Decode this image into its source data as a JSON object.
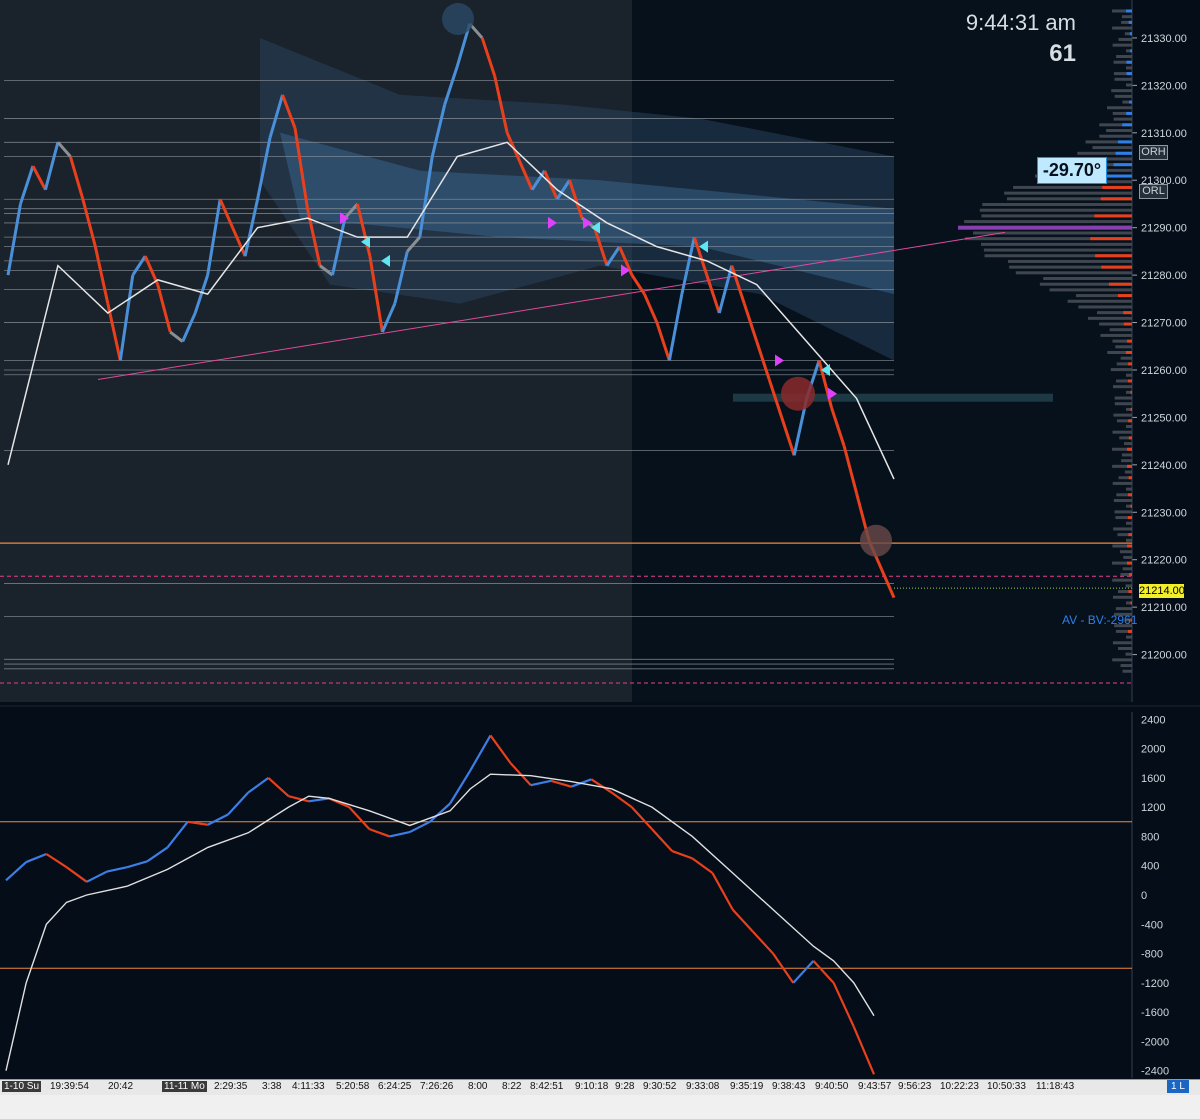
{
  "clock": {
    "time": "9:44:31 am",
    "count": "61"
  },
  "angle_badge": "-29.70°",
  "av_bv_label": "AV - BV:-2961",
  "last_price_tag": "21214.00",
  "level_tags": [
    "ORH",
    "ORL"
  ],
  "pane_markers": [
    "1 L"
  ],
  "colors": {
    "background": "#040d18",
    "session_shade": "#1b2430",
    "bull": "#4a90d9",
    "bear": "#e8401c",
    "neutral": "#8a8f94",
    "ma": "#e6e6e6",
    "orange_level": "#f08a3e",
    "pink_level": "#e83e8c",
    "trendline": "#e04a9a",
    "magenta_marker": "#e040fb",
    "cyan_marker": "#5fe6f0",
    "price_tag": "#f2ee2a"
  },
  "chart_data": [
    {
      "type": "line",
      "title": "",
      "ylim": [
        21190,
        21338
      ],
      "y_ticks": [
        "21330.00",
        "21320.00",
        "21310.00",
        "21300.00",
        "21290.00",
        "21280.00",
        "21270.00",
        "21260.00",
        "21250.00",
        "21240.00",
        "21230.00",
        "21220.00",
        "21210.00",
        "21200.00"
      ],
      "y_tick_values": [
        21330,
        21320,
        21310,
        21300,
        21290,
        21280,
        21270,
        21260,
        21250,
        21240,
        21230,
        21220,
        21210,
        21200
      ],
      "last_price": 21214.0,
      "orange_level": 21223.5,
      "pink_dashed_levels": [
        21216.5,
        21194
      ],
      "horizontal_levels": [
        21321,
        21313,
        21308,
        21305,
        21296,
        21294,
        21293,
        21291,
        21288,
        21286,
        21283,
        21281,
        21277,
        21270,
        21262,
        21260,
        21259,
        21243,
        21215,
        21208,
        21199,
        21198,
        21197
      ],
      "or_high": 21297,
      "or_low": 21294,
      "poc": 21290,
      "price_series": [
        {
          "x": 0,
          "y": 21280
        },
        {
          "x": 1,
          "y": 21295
        },
        {
          "x": 2,
          "y": 21303
        },
        {
          "x": 3,
          "y": 21298
        },
        {
          "x": 4,
          "y": 21308
        },
        {
          "x": 5,
          "y": 21305
        },
        {
          "x": 6,
          "y": 21296
        },
        {
          "x": 7,
          "y": 21286
        },
        {
          "x": 8,
          "y": 21274
        },
        {
          "x": 9,
          "y": 21262
        },
        {
          "x": 10,
          "y": 21280
        },
        {
          "x": 11,
          "y": 21284
        },
        {
          "x": 12,
          "y": 21278
        },
        {
          "x": 13,
          "y": 21268
        },
        {
          "x": 14,
          "y": 21266
        },
        {
          "x": 15,
          "y": 21272
        },
        {
          "x": 16,
          "y": 21280
        },
        {
          "x": 17,
          "y": 21296
        },
        {
          "x": 18,
          "y": 21290
        },
        {
          "x": 19,
          "y": 21284
        },
        {
          "x": 20,
          "y": 21296
        },
        {
          "x": 21,
          "y": 21309
        },
        {
          "x": 22,
          "y": 21318
        },
        {
          "x": 23,
          "y": 21311
        },
        {
          "x": 24,
          "y": 21294
        },
        {
          "x": 25,
          "y": 21282
        },
        {
          "x": 26,
          "y": 21280
        },
        {
          "x": 27,
          "y": 21292
        },
        {
          "x": 28,
          "y": 21295
        },
        {
          "x": 29,
          "y": 21284
        },
        {
          "x": 30,
          "y": 21268
        },
        {
          "x": 31,
          "y": 21274
        },
        {
          "x": 32,
          "y": 21285
        },
        {
          "x": 33,
          "y": 21288
        },
        {
          "x": 34,
          "y": 21305
        },
        {
          "x": 35,
          "y": 21316
        },
        {
          "x": 36,
          "y": 21324
        },
        {
          "x": 37,
          "y": 21333
        },
        {
          "x": 38,
          "y": 21330
        },
        {
          "x": 39,
          "y": 21322
        },
        {
          "x": 40,
          "y": 21310
        },
        {
          "x": 41,
          "y": 21304
        },
        {
          "x": 42,
          "y": 21298
        },
        {
          "x": 43,
          "y": 21302
        },
        {
          "x": 44,
          "y": 21296
        },
        {
          "x": 45,
          "y": 21300
        },
        {
          "x": 46,
          "y": 21292
        },
        {
          "x": 47,
          "y": 21290
        },
        {
          "x": 48,
          "y": 21282
        },
        {
          "x": 49,
          "y": 21286
        },
        {
          "x": 50,
          "y": 21280
        },
        {
          "x": 51,
          "y": 21276
        },
        {
          "x": 52,
          "y": 21270
        },
        {
          "x": 53,
          "y": 21262
        },
        {
          "x": 54,
          "y": 21276
        },
        {
          "x": 55,
          "y": 21288
        },
        {
          "x": 56,
          "y": 21280
        },
        {
          "x": 57,
          "y": 21272
        },
        {
          "x": 58,
          "y": 21282
        },
        {
          "x": 59,
          "y": 21274
        },
        {
          "x": 60,
          "y": 21266
        },
        {
          "x": 61,
          "y": 21258
        },
        {
          "x": 62,
          "y": 21250
        },
        {
          "x": 63,
          "y": 21242
        },
        {
          "x": 64,
          "y": 21254
        },
        {
          "x": 65,
          "y": 21262
        },
        {
          "x": 66,
          "y": 21252
        },
        {
          "x": 67,
          "y": 21244
        },
        {
          "x": 68,
          "y": 21234
        },
        {
          "x": 69,
          "y": 21224
        },
        {
          "x": 70,
          "y": 21218
        },
        {
          "x": 71,
          "y": 21212
        }
      ],
      "moving_average": [
        {
          "x": 0,
          "y": 21240
        },
        {
          "x": 4,
          "y": 21282
        },
        {
          "x": 8,
          "y": 21272
        },
        {
          "x": 12,
          "y": 21279
        },
        {
          "x": 16,
          "y": 21276
        },
        {
          "x": 20,
          "y": 21290
        },
        {
          "x": 24,
          "y": 21292
        },
        {
          "x": 28,
          "y": 21288
        },
        {
          "x": 32,
          "y": 21288
        },
        {
          "x": 36,
          "y": 21305
        },
        {
          "x": 40,
          "y": 21308
        },
        {
          "x": 44,
          "y": 21298
        },
        {
          "x": 48,
          "y": 21291
        },
        {
          "x": 52,
          "y": 21286
        },
        {
          "x": 56,
          "y": 21283
        },
        {
          "x": 60,
          "y": 21278
        },
        {
          "x": 64,
          "y": 21266
        },
        {
          "x": 68,
          "y": 21254
        },
        {
          "x": 71,
          "y": 21237
        }
      ],
      "x_ticks": [
        "1-10 Su",
        "19:39:54",
        "20:42",
        "11-11 Mo",
        "2:29:35",
        "3:38",
        "4:11:33",
        "5:20:58",
        "6:24:25",
        "7:26:26",
        "8:00",
        "8:22",
        "8:42:51",
        "9:10:18",
        "9:28",
        "9:30:52",
        "9:33:08",
        "9:35:19",
        "9:38:43",
        "9:40:50",
        "9:43:57",
        "9:56:23",
        "10:22:23",
        "10:50:33",
        "11:18:43"
      ]
    },
    {
      "type": "line",
      "title": "",
      "ylim": [
        -2500,
        2500
      ],
      "y_ticks": [
        "2400",
        "2000",
        "1600",
        "1200",
        "800",
        "400",
        "0",
        "-400",
        "-800",
        "-1200",
        "-1600",
        "-2000",
        "-2400"
      ],
      "y_tick_values": [
        2400,
        2000,
        1600,
        1200,
        800,
        400,
        0,
        -400,
        -800,
        -1200,
        -1600,
        -2000,
        -2400
      ],
      "orange_levels": [
        1000,
        -1000
      ],
      "series": [
        {
          "values": [
            {
              "x": 0,
              "y": 200
            },
            {
              "x": 2,
              "y": 450
            },
            {
              "x": 4,
              "y": 560
            },
            {
              "x": 6,
              "y": 380
            },
            {
              "x": 8,
              "y": 180
            },
            {
              "x": 10,
              "y": 320
            },
            {
              "x": 12,
              "y": 380
            },
            {
              "x": 14,
              "y": 460
            },
            {
              "x": 16,
              "y": 650
            },
            {
              "x": 18,
              "y": 1000
            },
            {
              "x": 20,
              "y": 960
            },
            {
              "x": 22,
              "y": 1100
            },
            {
              "x": 24,
              "y": 1400
            },
            {
              "x": 26,
              "y": 1600
            },
            {
              "x": 28,
              "y": 1350
            },
            {
              "x": 30,
              "y": 1280
            },
            {
              "x": 32,
              "y": 1320
            },
            {
              "x": 34,
              "y": 1200
            },
            {
              "x": 36,
              "y": 900
            },
            {
              "x": 38,
              "y": 800
            },
            {
              "x": 40,
              "y": 860
            },
            {
              "x": 42,
              "y": 1000
            },
            {
              "x": 44,
              "y": 1250
            },
            {
              "x": 46,
              "y": 1700
            },
            {
              "x": 48,
              "y": 2180
            },
            {
              "x": 50,
              "y": 1800
            },
            {
              "x": 52,
              "y": 1500
            },
            {
              "x": 54,
              "y": 1560
            },
            {
              "x": 56,
              "y": 1480
            },
            {
              "x": 58,
              "y": 1580
            },
            {
              "x": 60,
              "y": 1400
            },
            {
              "x": 62,
              "y": 1200
            },
            {
              "x": 64,
              "y": 900
            },
            {
              "x": 66,
              "y": 600
            },
            {
              "x": 68,
              "y": 500
            },
            {
              "x": 70,
              "y": 300
            },
            {
              "x": 72,
              "y": -200
            },
            {
              "x": 74,
              "y": -500
            },
            {
              "x": 76,
              "y": -800
            },
            {
              "x": 78,
              "y": -1200
            },
            {
              "x": 80,
              "y": -900
            },
            {
              "x": 82,
              "y": -1200
            },
            {
              "x": 84,
              "y": -1800
            },
            {
              "x": 86,
              "y": -2450
            }
          ]
        },
        {
          "values": [
            {
              "x": 0,
              "y": -2400
            },
            {
              "x": 2,
              "y": -1200
            },
            {
              "x": 4,
              "y": -400
            },
            {
              "x": 6,
              "y": -100
            },
            {
              "x": 8,
              "y": 0
            },
            {
              "x": 12,
              "y": 120
            },
            {
              "x": 16,
              "y": 350
            },
            {
              "x": 20,
              "y": 650
            },
            {
              "x": 24,
              "y": 850
            },
            {
              "x": 28,
              "y": 1200
            },
            {
              "x": 30,
              "y": 1350
            },
            {
              "x": 32,
              "y": 1320
            },
            {
              "x": 36,
              "y": 1150
            },
            {
              "x": 40,
              "y": 950
            },
            {
              "x": 44,
              "y": 1150
            },
            {
              "x": 46,
              "y": 1450
            },
            {
              "x": 48,
              "y": 1650
            },
            {
              "x": 52,
              "y": 1630
            },
            {
              "x": 56,
              "y": 1550
            },
            {
              "x": 60,
              "y": 1450
            },
            {
              "x": 64,
              "y": 1200
            },
            {
              "x": 68,
              "y": 800
            },
            {
              "x": 72,
              "y": 300
            },
            {
              "x": 76,
              "y": -200
            },
            {
              "x": 80,
              "y": -700
            },
            {
              "x": 82,
              "y": -900
            },
            {
              "x": 84,
              "y": -1200
            },
            {
              "x": 86,
              "y": -1650
            }
          ]
        }
      ]
    }
  ]
}
